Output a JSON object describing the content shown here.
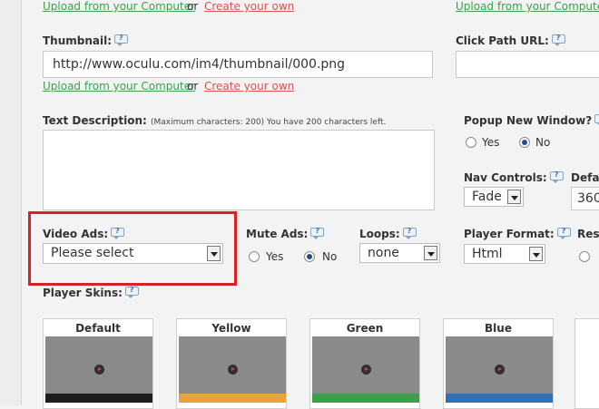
{
  "top_links": {
    "upload_left": "Upload from your Computer",
    "or_left": "or",
    "create_left": "Create your own",
    "upload_right": "Upload from your Computer"
  },
  "thumbnail": {
    "label": "Thumbnail:",
    "value": "http://www.oculu.com/im4/thumbnail/000.png",
    "upload": "Upload from your Computer",
    "or": "or",
    "create": "Create your own"
  },
  "click_path": {
    "label": "Click Path URL:",
    "value": ""
  },
  "text_description": {
    "label": "Text Description:",
    "note": "(Maximum characters: 200) You have 200 characters left."
  },
  "popup_new_window": {
    "label": "Popup New Window?",
    "yes": "Yes",
    "no": "No",
    "selected": "No"
  },
  "nav_controls": {
    "label": "Nav Controls:",
    "value": "Fade"
  },
  "default_partial": {
    "label": "Defau",
    "value": "360"
  },
  "video_ads": {
    "label": "Video Ads:",
    "value": "Please select"
  },
  "mute_ads": {
    "label": "Mute Ads:",
    "yes": "Yes",
    "no": "No",
    "selected": "No"
  },
  "loops": {
    "label": "Loops:",
    "value": "none"
  },
  "player_format": {
    "label": "Player Format:",
    "value": "Html"
  },
  "responsive_partial": {
    "label": "Resp"
  },
  "player_skins": {
    "label": "Player Skins:",
    "skins": [
      {
        "name": "Default",
        "bar_color": "#1c1c1c"
      },
      {
        "name": "Yellow",
        "bar_color": "#e9a23b"
      },
      {
        "name": "Green",
        "bar_color": "#3aa14b"
      },
      {
        "name": "Blue",
        "bar_color": "#2e6fb5"
      }
    ]
  },
  "colors": {
    "highlight": "#e02020",
    "link_green": "#3aa14b",
    "link_red": "#d9534f"
  }
}
